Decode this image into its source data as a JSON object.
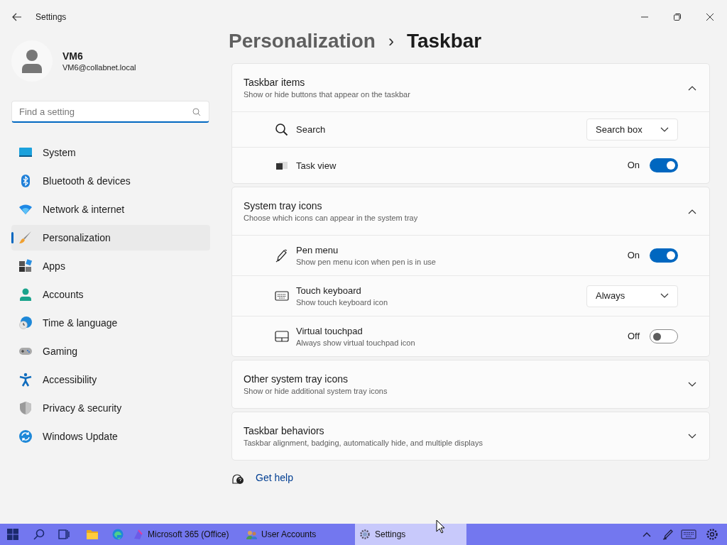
{
  "window": {
    "title": "Settings"
  },
  "user": {
    "name": "VM6",
    "email": "VM6@collabnet.local"
  },
  "search": {
    "placeholder": "Find a setting"
  },
  "nav": [
    {
      "label": "System",
      "selected": false
    },
    {
      "label": "Bluetooth & devices",
      "selected": false
    },
    {
      "label": "Network & internet",
      "selected": false
    },
    {
      "label": "Personalization",
      "selected": true
    },
    {
      "label": "Apps",
      "selected": false
    },
    {
      "label": "Accounts",
      "selected": false
    },
    {
      "label": "Time & language",
      "selected": false
    },
    {
      "label": "Gaming",
      "selected": false
    },
    {
      "label": "Accessibility",
      "selected": false
    },
    {
      "label": "Privacy & security",
      "selected": false
    },
    {
      "label": "Windows Update",
      "selected": false
    }
  ],
  "breadcrumb": {
    "parent": "Personalization",
    "separator": "›",
    "current": "Taskbar"
  },
  "groups": [
    {
      "title": "Taskbar items",
      "subtitle": "Show or hide buttons that appear on the taskbar",
      "expanded": true,
      "rows": [
        {
          "kind": "dropdown",
          "label": "Search",
          "value": "Search box"
        },
        {
          "kind": "toggle",
          "label": "Task view",
          "state_text": "On",
          "on": true
        }
      ]
    },
    {
      "title": "System tray icons",
      "subtitle": "Choose which icons can appear in the system tray",
      "expanded": true,
      "rows": [
        {
          "kind": "toggle",
          "label": "Pen menu",
          "description": "Show pen menu icon when pen is in use",
          "state_text": "On",
          "on": true
        },
        {
          "kind": "dropdown",
          "label": "Touch keyboard",
          "description": "Show touch keyboard icon",
          "value": "Always"
        },
        {
          "kind": "toggle",
          "label": "Virtual touchpad",
          "description": "Always show virtual touchpad icon",
          "state_text": "Off",
          "on": false
        }
      ]
    },
    {
      "title": "Other system tray icons",
      "subtitle": "Show or hide additional system tray icons",
      "expanded": false
    },
    {
      "title": "Taskbar behaviors",
      "subtitle": "Taskbar alignment, badging, automatically hide, and multiple displays",
      "expanded": false
    }
  ],
  "help": {
    "label": "Get help"
  },
  "taskbar": {
    "apps": [
      {
        "label": "Microsoft 365 (Office)",
        "selected": false
      },
      {
        "label": "User Accounts",
        "selected": false
      },
      {
        "label": "Settings",
        "selected": true
      }
    ]
  }
}
